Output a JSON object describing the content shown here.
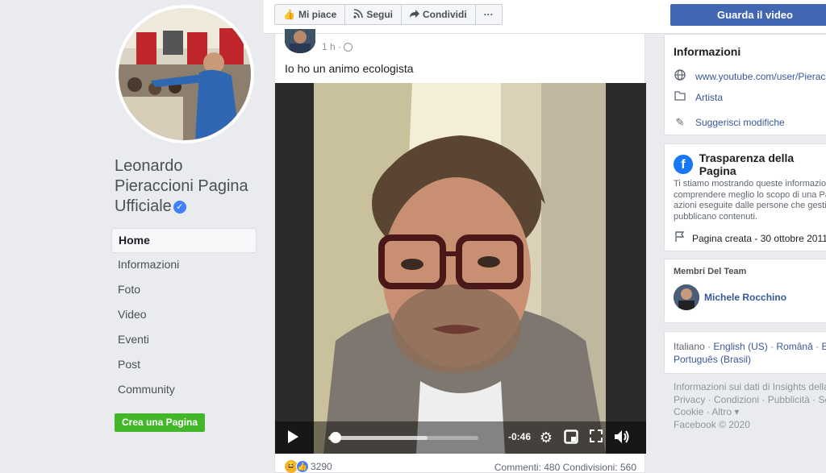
{
  "left": {
    "page_name": "Leonardo Pieraccioni Pagina Ufficiale",
    "nav": [
      "Home",
      "Informazioni",
      "Foto",
      "Video",
      "Eventi",
      "Post",
      "Community"
    ],
    "create_page": "Crea una Pagina"
  },
  "topbar": {
    "like": "Mi piace",
    "follow": "Segui",
    "share": "Condividi",
    "more": "···",
    "watch_video": "Guarda il video"
  },
  "post": {
    "time": "1 h ·",
    "text": "Io ho un animo ecologista",
    "video": {
      "time_remaining": "-0:46",
      "progress": 0.05,
      "buffered": 0.66
    },
    "reactions": "3290",
    "comments": "Commenti: 480",
    "shares": "Condivisioni: 560"
  },
  "right": {
    "info": {
      "title": "Informazioni",
      "website": "www.youtube.com/user/Pieracc",
      "category": "Artista",
      "suggest": "Suggerisci modifiche"
    },
    "transparency": {
      "title": "Trasparenza della Pagina",
      "body_lines": [
        "Ti stiamo mostrando queste informazioni",
        "comprendere meglio lo scopo di una Pag",
        "azioni eseguite dalle persone che gestis",
        "pubblicano contenuti."
      ],
      "created": "Pagina creata - 30 ottobre 2011"
    },
    "team": {
      "title": "Membri Del Team",
      "member": "Michele Rocchino"
    },
    "languages": {
      "current": "Italiano",
      "links": [
        "English (US)",
        "Română",
        "Es",
        "Português (Brasil)"
      ]
    },
    "footer": {
      "line1": "Informazioni sui dati di Insights della",
      "links": [
        "Privacy",
        "Condizioni",
        "Pubblicità",
        "Sc",
        "Cookie",
        "Altro"
      ],
      "copyright": "Facebook © 2020"
    }
  }
}
